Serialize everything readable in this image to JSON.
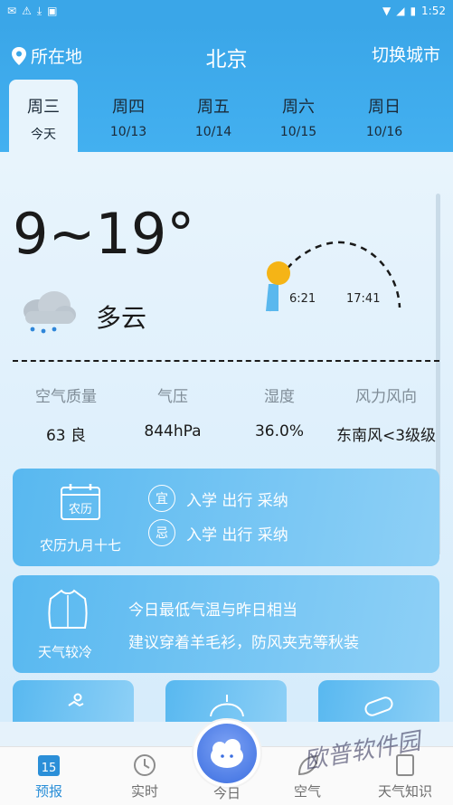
{
  "status_bar": {
    "time": "1:52"
  },
  "header": {
    "location_label": "所在地",
    "city": "北京",
    "switch_city": "切换城市"
  },
  "days": [
    {
      "name": "周三",
      "date": "今天"
    },
    {
      "name": "周四",
      "date": "10/13"
    },
    {
      "name": "周五",
      "date": "10/14"
    },
    {
      "name": "周六",
      "date": "10/15"
    },
    {
      "name": "周日",
      "date": "10/16"
    }
  ],
  "weather": {
    "temp_range": "9~19°",
    "condition": "多云",
    "sunrise": "6:21",
    "sunset": "17:41"
  },
  "stats": [
    {
      "label": "空气质量",
      "value": "63 良"
    },
    {
      "label": "气压",
      "value": "844hPa"
    },
    {
      "label": "湿度",
      "value": "36.0%"
    },
    {
      "label": "风力风向",
      "value": "东南风<3级级"
    }
  ],
  "calendar_card": {
    "icon_text": "农历",
    "lunar_date": "农历九月十七",
    "yi_badge": "宜",
    "yi_items": "入学 出行 采纳",
    "ji_badge": "忌",
    "ji_items": "入学 出行 采纳"
  },
  "dress_card": {
    "label": "天气较冷",
    "line1": "今日最低气温与昨日相当",
    "line2": "建议穿着羊毛衫，防风夹克等秋装"
  },
  "nav": {
    "forecast": "预报",
    "forecast_icon_text": "15",
    "realtime": "实时",
    "today": "今日",
    "air": "空气",
    "knowledge": "天气知识"
  },
  "watermark": "欧普软件园",
  "colors": {
    "primary": "#3aa6e8",
    "card": "#58b8f0",
    "sun": "#f5b416",
    "nav_active": "#2b8fd8"
  }
}
